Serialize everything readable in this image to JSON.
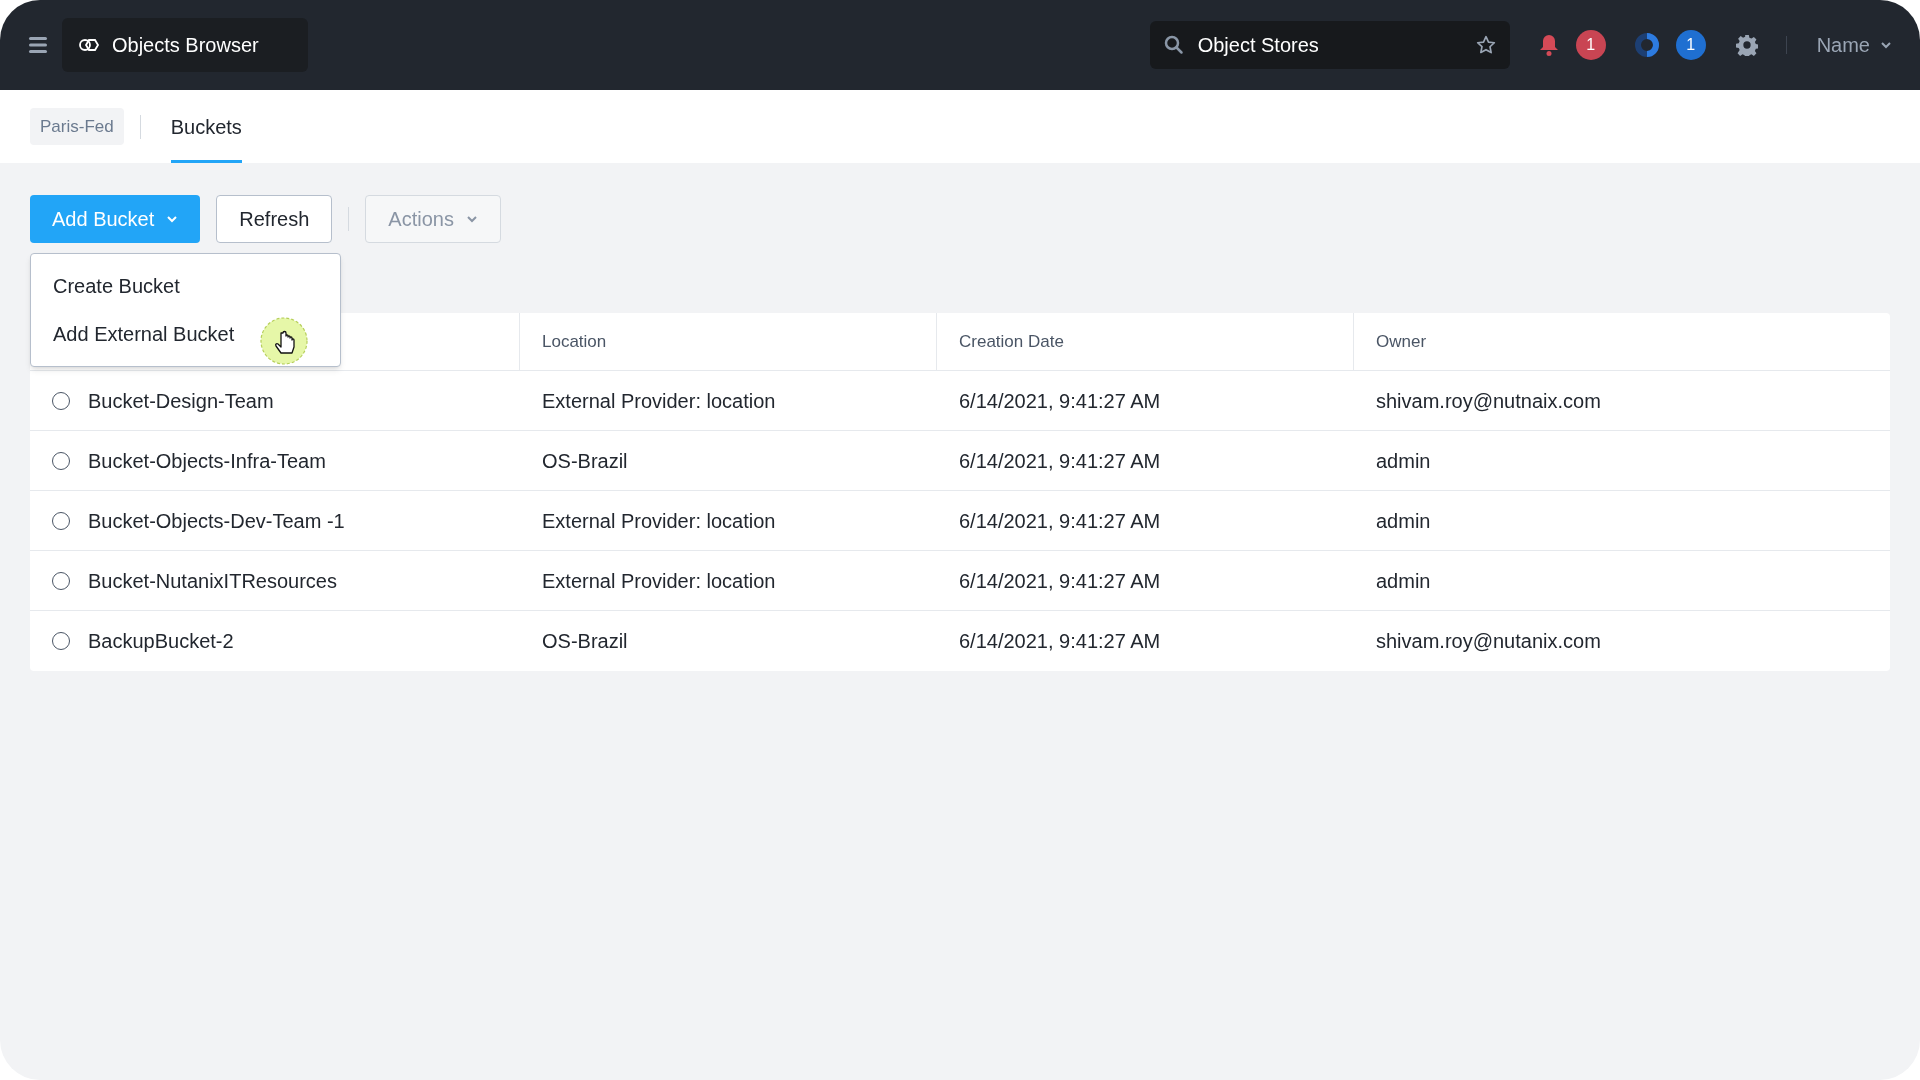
{
  "header": {
    "app_title": "Objects Browser",
    "search": {
      "value": "Object Stores"
    },
    "notifications": {
      "count": "1"
    },
    "tasks": {
      "count": "1"
    },
    "user_menu": "Name"
  },
  "breadcrumb": "Paris-Fed",
  "tabs": [
    {
      "label": "Buckets",
      "selected": true
    }
  ],
  "toolbar": {
    "buttons": [
      {
        "label": "Add Bucket",
        "kind": "primary",
        "disabled": false
      },
      {
        "label": "Refresh",
        "kind": "plain",
        "disabled": false
      },
      {
        "label": "Actions",
        "kind": "menu",
        "disabled": true
      }
    ]
  },
  "dropdown": {
    "open": true,
    "items": [
      {
        "label": "Create Bucket",
        "hovered": false
      },
      {
        "label": "Add External Bucket",
        "hovered": true
      }
    ]
  },
  "table": {
    "columns": [
      "",
      "Location",
      "Creation Date",
      "Owner"
    ],
    "rows": [
      {
        "selected": false,
        "cells": [
          "Bucket-Design-Team",
          "External Provider: location",
          "6/14/2021, 9:41:27 AM",
          "shivam.roy@nutnaix.com"
        ]
      },
      {
        "selected": false,
        "cells": [
          "Bucket-Objects-Infra-Team",
          "OS-Brazil",
          "6/14/2021, 9:41:27 AM",
          "admin"
        ]
      },
      {
        "selected": false,
        "cells": [
          "Bucket-Objects-Dev-Team -1",
          "External Provider: location",
          "6/14/2021, 9:41:27 AM",
          "admin"
        ]
      },
      {
        "selected": false,
        "cells": [
          "Bucket-NutanixITResources",
          "External Provider: location",
          "6/14/2021, 9:41:27 AM",
          "admin"
        ]
      },
      {
        "selected": false,
        "cells": [
          "BackupBucket-2",
          "OS-Brazil",
          "6/14/2021, 9:41:27 AM",
          "shivam.roy@nutanix.com"
        ]
      }
    ]
  }
}
